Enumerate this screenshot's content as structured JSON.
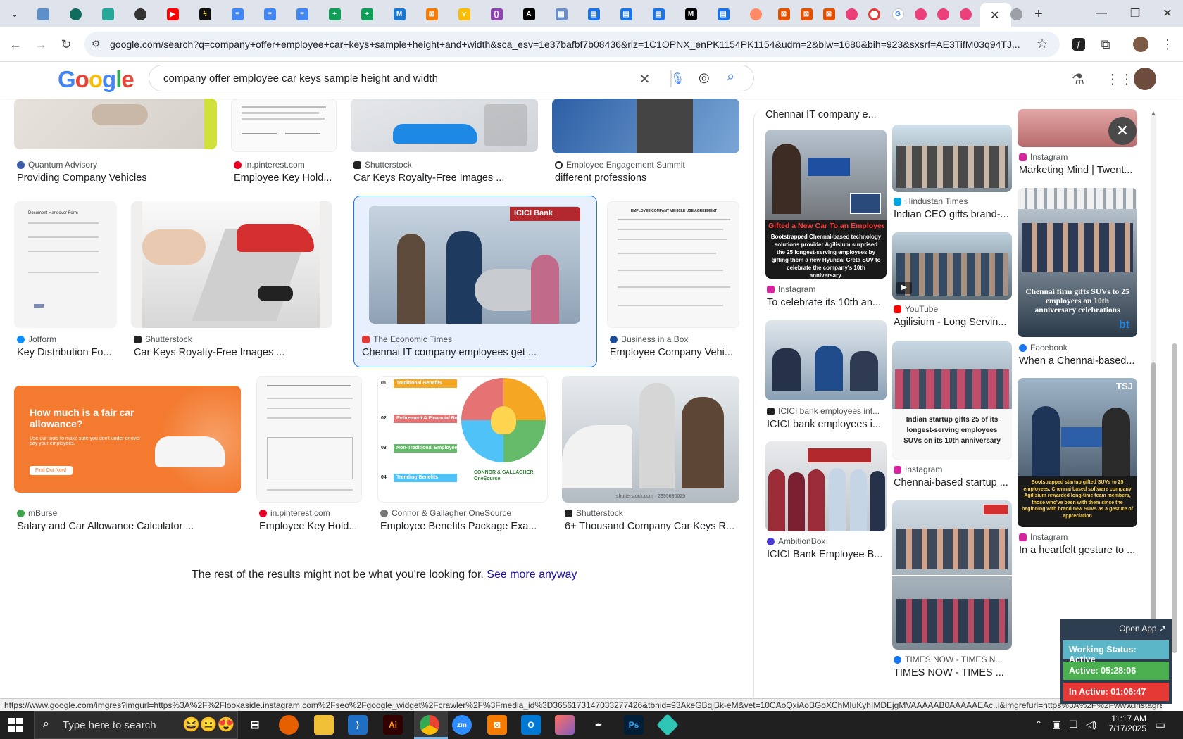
{
  "browser": {
    "url": "google.com/search?q=company+offer+employee+car+keys+sample+height+and+width&sca_esv=1e37bafbf7b08436&rlz=1C1OPNX_enPK1154PK1154&udm=2&biw=1680&bih=923&sxsrf=AE3TifM03q94TJ...",
    "status_url": "https://www.google.com/imgres?imgurl=https%3A%2F%2Flookaside.instagram.com%2Fseo%2Fgoogle_widget%2Fcrawler%2F%3Fmedia_id%3D3656173147033277426&tbnid=93AkeGBqjBk-eM&vet=10CAoQxiAoBGoXChMIuKyhIMDEjgMVAAAAAB0AAAAAEAc..i&imgrefurl=https%3A%2F%2Fwww.instagram..."
  },
  "search": {
    "query": "company offer employee car keys sample height and width"
  },
  "results": [
    {
      "source": "Quantum Advisory",
      "title": "Providing Company Vehicles"
    },
    {
      "source": "in.pinterest.com",
      "title": "Employee Key Hold..."
    },
    {
      "source": "Shutterstock",
      "title": "Car Keys Royalty-Free Images ..."
    },
    {
      "source": "Employee Engagement Summit",
      "title": "different professions"
    },
    {
      "source": "Jotform",
      "title": "Key Distribution Fo..."
    },
    {
      "source": "Shutterstock",
      "title": "Car Keys Royalty-Free Images ..."
    },
    {
      "source": "The Economic Times",
      "title": "Chennai IT company employees get ..."
    },
    {
      "source": "Business in a Box",
      "title": "Employee Company Vehi..."
    },
    {
      "source": "mBurse",
      "title": "Salary and Car Allowance Calculator ..."
    },
    {
      "source": "in.pinterest.com",
      "title": "Employee Key Hold..."
    },
    {
      "source": "Connor & Gallagher OneSource",
      "title": "Employee Benefits Package Exa..."
    },
    {
      "source": "Shutterstock",
      "title": "6+ Thousand Company Car Keys R..."
    }
  ],
  "thumb_text": {
    "jotform_title": "Document Handover Form",
    "vehicle_agreement": "EMPLOYEE COMPANY VEHICLE USE AGREEMENT",
    "icici": "ICICI Bank",
    "mburse_head": "How much is a fair car allowance?",
    "mburse_sub": "Use our tools to make sure you don't under or over pay your employees.",
    "mburse_btn": "Find Out Now!",
    "benefits": [
      "Traditional Benefits",
      "Retirement & Financial Benefits",
      "Non-Traditional Employee Paid Benefits",
      "Trending Benefits"
    ],
    "benefit_nums": [
      "01",
      "02",
      "03",
      "04"
    ],
    "connor": "CONNOR & GALLAGHER OneSource",
    "shutter_id": "shutterstock.com · 2395630625"
  },
  "end_message": {
    "text": "The rest of the results might not be what you're looking for.",
    "link": "See more anyway"
  },
  "related": {
    "top_caption": "Chennai IT company e...",
    "col1": [
      {
        "source": "Instagram",
        "title": "To celebrate its 10th an...",
        "overlay_head": "Gifted a New Car To an Employee",
        "overlay_body": "Bootstrapped Chennai-based technology solutions provider Agilisium surprised the 25 longest-serving employees by gifting them a new Hyundai Creta SUV to celebrate the company's 10th anniversary."
      },
      {
        "source": "ICICI bank employees int...",
        "title": "ICICI bank employees i..."
      },
      {
        "source": "AmbitionBox",
        "title": "ICICI Bank Employee B..."
      }
    ],
    "col2": [
      {
        "source": "Hindustan Times",
        "title": "Indian CEO gifts brand-..."
      },
      {
        "source": "YouTube",
        "title": "Agilisium - Long Servin..."
      },
      {
        "source": "Instagram",
        "title": "Chennai-based startup ...",
        "overlay": "Indian startup gifts 25 of its longest-serving employees SUVs on its 10th anniversary"
      },
      {
        "source": "TIMES NOW - TIMES N...",
        "title": "TIMES NOW - TIMES ..."
      }
    ],
    "col3": [
      {
        "source": "Instagram",
        "title": "Marketing Mind | Twent..."
      },
      {
        "source": "Facebook",
        "title": "When a Chennai-based...",
        "overlay": "Chennai firm gifts SUVs to 25 employees on 10th anniversary celebrations",
        "brand": "bt"
      },
      {
        "source": "Instagram",
        "title": "In a heartfelt gesture to ...",
        "overlay": "Bootstrapped startup gifted SUVs to 25 employees. Chennai based software company Agilisium rewarded long-time team members, those who've been with them since the beginning with brand new SUVs as a gesture of appreciation",
        "brand": "TSJ"
      }
    ]
  },
  "widget": {
    "open_app": "Open App ↗",
    "status": "Working Status: Active",
    "active": "Active: 05:28:06",
    "inactive": "In Active: 01:06:47"
  },
  "taskbar": {
    "search_placeholder": "Type here to search",
    "time": "11:17 AM",
    "date": "7/17/2025"
  },
  "colors": {
    "accent": "#1a0dab",
    "selected_border": "#1a73e8",
    "widget_active": "#4caf50",
    "widget_inactive": "#e53935",
    "widget_status": "#5bb7c8"
  }
}
